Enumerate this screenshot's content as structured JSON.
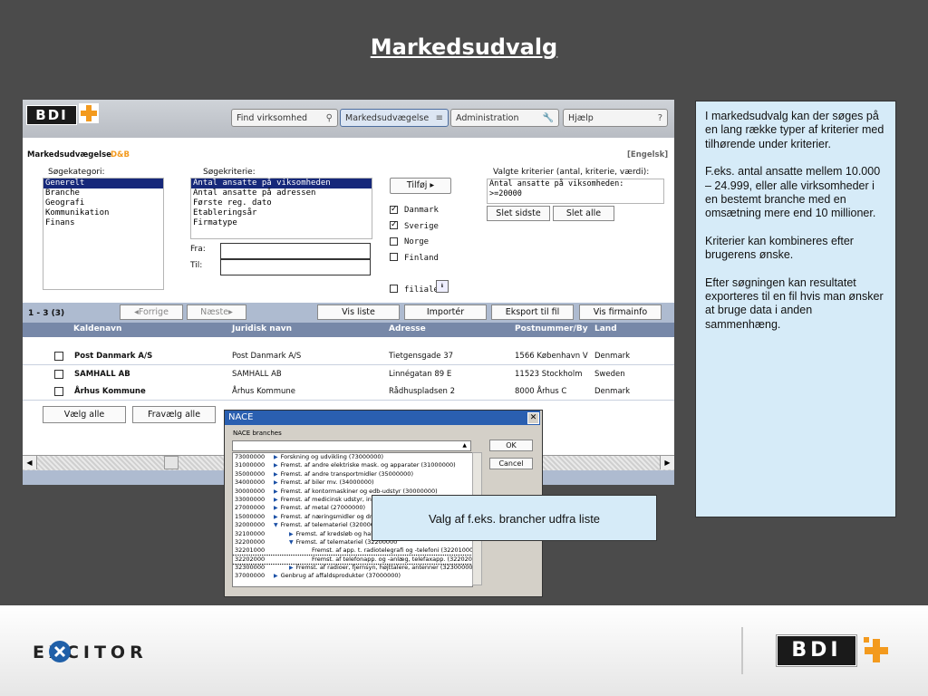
{
  "slide_title": "Markedsudvalg",
  "app": {
    "logo_text": "BDI",
    "nav": [
      "Find virksomhed",
      "Markedsudvægelse",
      "Administration",
      "Hjælp"
    ],
    "panel_title": "Markedsudvægelse",
    "panel_tag": "D&B",
    "lang_link": "[Engelsk]",
    "category_label": "Søgekategori:",
    "categories": [
      "Generelt",
      "Branche",
      "Geografi",
      "Kommunikation",
      "Finans"
    ],
    "criteria_label": "Søgekriterie:",
    "criteria": [
      "Antal ansatte på viksomheden",
      "Antal ansatte på adressen",
      "Første reg. dato",
      "Etableringsår",
      "Firmatype"
    ],
    "fra_label": "Fra:",
    "til_label": "Til:",
    "add_button": "Tilføj ▸",
    "countries": [
      {
        "label": "Danmark",
        "checked": true
      },
      {
        "label": "Sverige",
        "checked": true
      },
      {
        "label": "Norge",
        "checked": false
      },
      {
        "label": "Finland",
        "checked": false
      }
    ],
    "filialer_label": "filialer",
    "selected_label": "Valgte kriterier (antal, kriterie, værdi):",
    "selected_values": [
      "Antal ansatte på viksomheden:",
      ">=20000"
    ],
    "delete_last": "Slet sidste",
    "delete_all": "Slet alle",
    "result_count": "1 - 3  (3)",
    "prev_btn": "◂Forrige",
    "next_btn": "Næste▸",
    "action_buttons": [
      "Vis liste",
      "Importér",
      "Eksport til fil",
      "Vis firmainfo"
    ],
    "columns": [
      "Kaldenavn",
      "Juridisk navn",
      "Adresse",
      "Postnummer/By",
      "Land"
    ],
    "rows": [
      [
        "Post Danmark A/S",
        "Post Danmark A/S",
        "Tietgensgade 37",
        "1566 København V",
        "Denmark"
      ],
      [
        "SAMHALL AB",
        "SAMHALL AB",
        "Linnégatan 89  E",
        "11523 Stockholm",
        "Sweden"
      ],
      [
        "Århus Kommune",
        "Århus Kommune",
        "Rådhuspladsen 2",
        "8000 Århus C",
        "Denmark"
      ]
    ],
    "select_all": "Vælg alle",
    "deselect_all": "Fravælg alle"
  },
  "nace": {
    "title": "NACE",
    "subtitle": "NACE branches",
    "ok": "OK",
    "cancel": "Cancel",
    "rows": [
      {
        "code": "73000000",
        "text": "Forskning og udvikling  (73000000)",
        "level": 0,
        "expanded": false
      },
      {
        "code": "31000000",
        "text": "Fremst. af andre elektriske mask. og apparater  (31000000)",
        "level": 0,
        "expanded": false
      },
      {
        "code": "35000000",
        "text": "Fremst. af andre transportmidler  (35000000)",
        "level": 0,
        "expanded": false
      },
      {
        "code": "34000000",
        "text": "Fremst. af biler mv.  (34000000)",
        "level": 0,
        "expanded": false
      },
      {
        "code": "30000000",
        "text": "Fremst. af kontormaskiner og edb-udstyr  (30000000)",
        "level": 0,
        "expanded": false
      },
      {
        "code": "33000000",
        "text": "Fremst. af medicinsk udstyr, instru",
        "level": 0,
        "expanded": false
      },
      {
        "code": "27000000",
        "text": "Fremst. af metal  (27000000)",
        "level": 0,
        "expanded": false
      },
      {
        "code": "15000000",
        "text": "Fremst. af næringsmidler og drikke",
        "level": 0,
        "expanded": false
      },
      {
        "code": "32000000",
        "text": "Fremst. af telemateriel  (32000000",
        "level": 0,
        "expanded": true
      },
      {
        "code": "32100000",
        "text": "Fremst. af kredsløb og halvl",
        "level": 1,
        "expanded": false
      },
      {
        "code": "32200000",
        "text": "Fremst. af telemateriel  (32200000",
        "level": 1,
        "expanded": true
      },
      {
        "code": "32201000",
        "text": "Fremst. af app. t. radiotelegrafi og -telefoni  (32201000)",
        "level": 2,
        "expanded": null
      },
      {
        "code": "32202000",
        "text": "Fremst. af telefonapp. og -anlæg, telefaxapp.  (32202000)",
        "level": 2,
        "expanded": null
      },
      {
        "code": "32300000",
        "text": "Fremst. af radioer, fjernsyn, højttalere, antenner  (32300000)",
        "level": 1,
        "expanded": false
      },
      {
        "code": "37000000",
        "text": "Genbrug af affaldsprodukter  (37000000)",
        "level": 0,
        "expanded": false
      }
    ]
  },
  "description": [
    "I markedsudvalg kan der søges på en lang række typer af kriterier med tilhørende under kriterier.",
    "F.eks. antal ansatte mellem 10.000 – 24.999, eller alle virksomheder i en bestemt branche med en omsætning mere end 10 millioner.",
    "Kriterier kan kombineres efter brugerens ønske.",
    "Efter søgningen kan resultatet exporteres til en fil hvis man ønsker at bruge data i anden sammenhæng."
  ],
  "callout": "Valg af f.eks. brancher udfra liste",
  "footer": {
    "excitor": "EXCITOR",
    "bdi": "BDI"
  },
  "colors": {
    "background": "#4b4b4b",
    "callout_bg": "#d6ebf8",
    "selection": "#16287a",
    "header_row": "#7788a8",
    "brand_orange": "#f39a1e"
  }
}
